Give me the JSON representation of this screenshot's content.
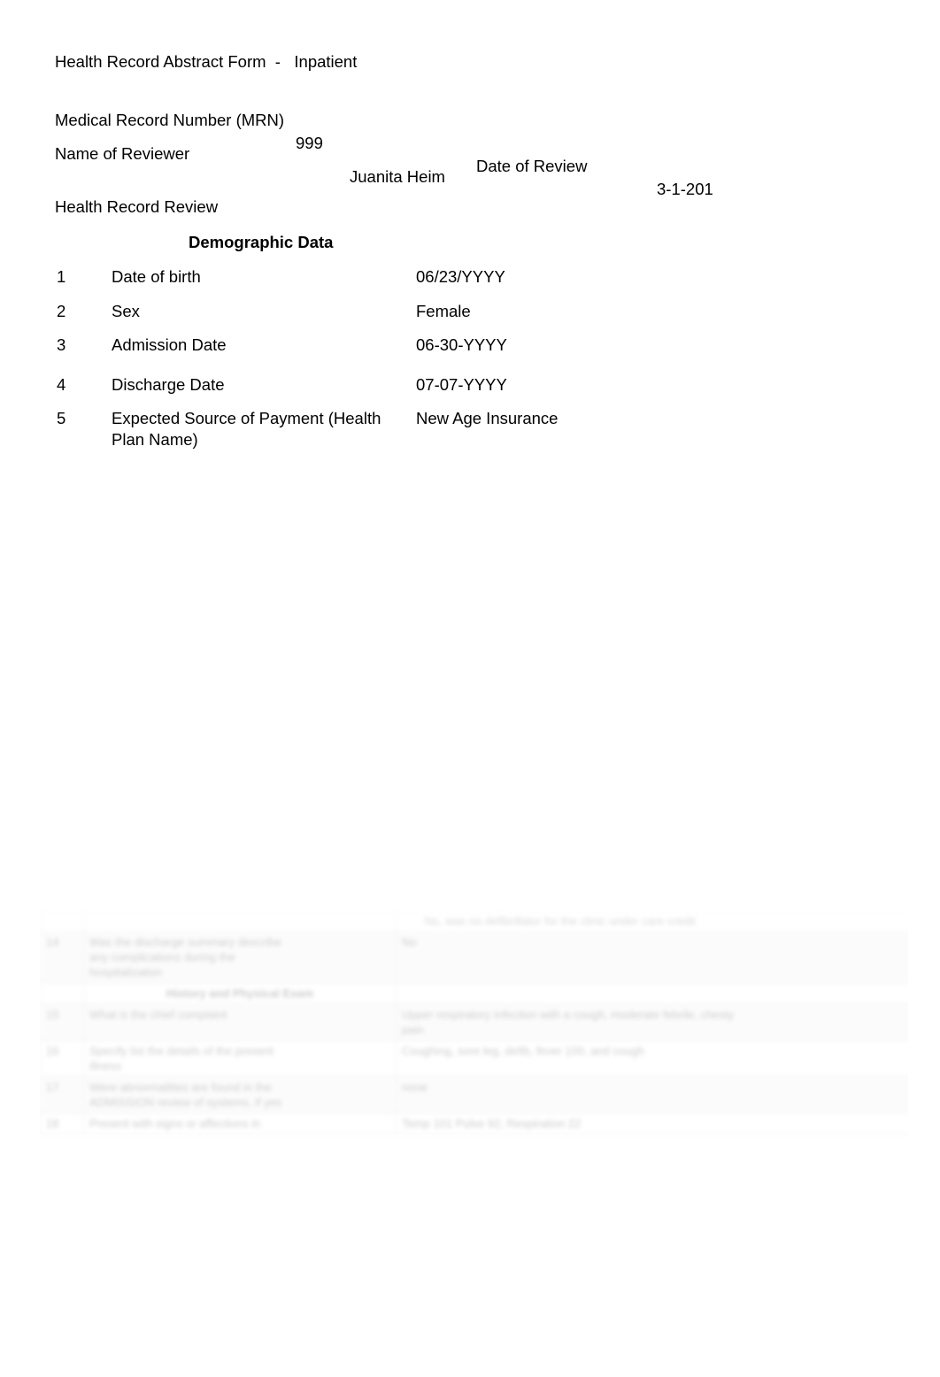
{
  "document": {
    "title": "Health Record Abstract Form  -   Inpatient",
    "header": {
      "mrn_label": "Medical Record Number (MRN)",
      "mrn_value": "999",
      "date_of_review_label": "Date of Review",
      "date_of_review_value": "3-1-201",
      "reviewer_label": "Name of Reviewer",
      "reviewer_value": "Juanita Heim"
    },
    "review_section_title": "Health Record Review",
    "demographic": {
      "heading": "Demographic Data",
      "rows": [
        {
          "num": "1",
          "label": "Date of birth",
          "value": "06/23/YYYY"
        },
        {
          "num": "2",
          "label": "Sex",
          "value": "Female"
        },
        {
          "num": "3",
          "label": "Admission Date",
          "value": "06-30-YYYY"
        },
        {
          "num": "4",
          "label": "Discharge Date",
          "value": "07-07-YYYY"
        },
        {
          "num": "5",
          "label": "Expected Source of Payment (Health Plan Name)",
          "value": "New Age Insurance"
        }
      ]
    },
    "ghost_table": {
      "note": "Faded partially-rendered continuation table at the bottom of the page; text is illegible in the screenshot.",
      "section_heading": "History and Physical Exam",
      "rows": [
        {
          "num": "",
          "item": "",
          "value": ""
        },
        {
          "num": "",
          "item": "",
          "value": ""
        },
        {
          "num": "",
          "item": "",
          "value": ""
        },
        {
          "num": "",
          "item": "",
          "value": ""
        },
        {
          "num": "",
          "item": "",
          "value": ""
        },
        {
          "num": "",
          "item": "",
          "value": ""
        },
        {
          "num": "",
          "item": "",
          "value": ""
        }
      ]
    }
  }
}
